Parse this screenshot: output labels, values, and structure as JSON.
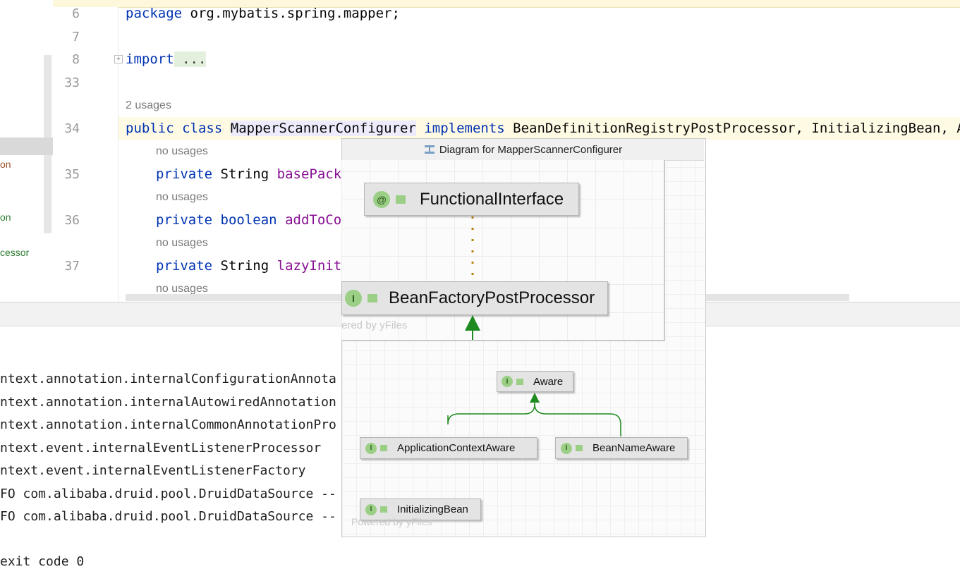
{
  "left_panel": {
    "items": [
      {
        "text": "on",
        "color": "#a0522d"
      },
      {
        "text": "on",
        "color": "#2e7d32"
      },
      {
        "text": "cessor",
        "color": "#2e7d32"
      }
    ]
  },
  "editor": {
    "line_numbers": [
      "6",
      "7",
      "8",
      "33",
      "34",
      "35",
      "36",
      "37"
    ],
    "package_kw": "package",
    "package_name": " org.mybatis.spring.mapper;",
    "import_kw": "import",
    "import_fold": " ...",
    "usages_hint": "2 usages",
    "class_line": {
      "public_kw": "public",
      "class_kw": "class",
      "class_name": "MapperScannerConfigurer",
      "implements_kw": "implements",
      "interfaces": "BeanDefinitionRegistryPostProcessor, InitializingBean, Appli"
    },
    "no_usages": "no usages",
    "fields": [
      {
        "mod": "private",
        "type": "String",
        "type_is_kw": false,
        "name": "basePacka"
      },
      {
        "mod": "private",
        "type": "boolean",
        "type_is_kw": true,
        "name": "addToCon"
      },
      {
        "mod": "private",
        "type": "String",
        "type_is_kw": false,
        "name": "lazyIniti"
      }
    ]
  },
  "console": {
    "lines": [
      "ntext.annotation.internalConfigurationAnnota",
      "ntext.annotation.internalAutowiredAnnotation",
      "ntext.annotation.internalCommonAnnotationPro",
      "ntext.event.internalEventListenerProcessor",
      "ntext.event.internalEventListenerFactory",
      "FO com.alibaba.druid.pool.DruidDataSource --",
      "FO com.alibaba.druid.pool.DruidDataSource --",
      "",
      "exit code 0"
    ]
  },
  "diagram": {
    "title": "Diagram for MapperScannerConfigurer",
    "title_icon": "diagram-icon",
    "zoom_nodes": {
      "functional_interface": {
        "badge": "@",
        "label": "FunctionalInterface"
      },
      "bean_factory_post_processor": {
        "badge": "I",
        "label": "BeanFactoryPostProcessor"
      }
    },
    "nodes": {
      "aware": {
        "badge": "I",
        "label": "Aware"
      },
      "application_context_aware": {
        "badge": "I",
        "label": "ApplicationContextAware"
      },
      "bean_name_aware": {
        "badge": "I",
        "label": "BeanNameAware"
      },
      "initializing_bean": {
        "badge": "I",
        "label": "InitializingBean"
      }
    },
    "watermark_zoom": "ered by yFiles",
    "watermark_bottom": "Powered by yFiles",
    "colors": {
      "arrow": "#1f8a1f",
      "dotted_edge": "#b8860b",
      "badge": "#9ccf86"
    }
  }
}
